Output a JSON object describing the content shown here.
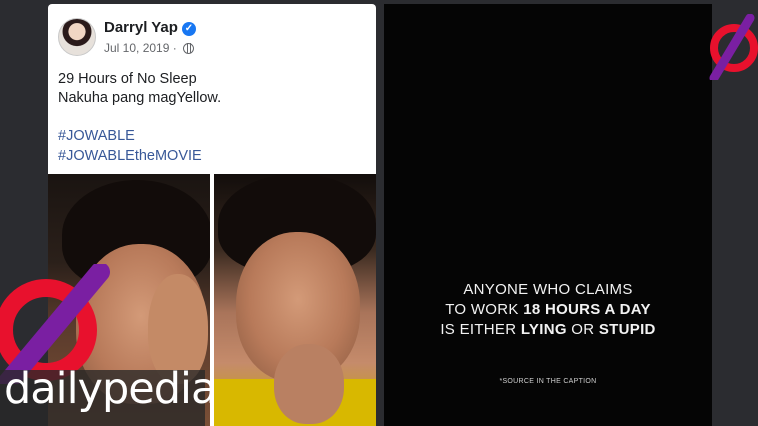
{
  "post": {
    "author": "Darryl Yap",
    "date": "Jul 10, 2019",
    "separator": "·",
    "text_line1": "29 Hours of No Sleep",
    "text_line2": "Nakuha pang magYellow.",
    "hashtag1": "#JOWABLE",
    "hashtag2": "#JOWABLEtheMOVIE",
    "icons": [
      "verified-badge-icon",
      "globe-icon"
    ]
  },
  "quote": {
    "line1": "ANYONE WHO CLAIMS",
    "line2_pre": "TO WORK ",
    "line2_bold": "18 HOURS A DAY",
    "line3_pre": "IS EITHER ",
    "line3_bold1": "LYING",
    "line3_mid": " OR ",
    "line3_bold2": "STUPID",
    "source": "*SOURCE IN THE CAPTION"
  },
  "brand": {
    "name": "dailypedia",
    "accent": "#e8112d",
    "accent2": "#7a1fa2"
  },
  "colors": {
    "background": "#2b2c30",
    "link": "#385898",
    "verified": "#1877f2"
  }
}
